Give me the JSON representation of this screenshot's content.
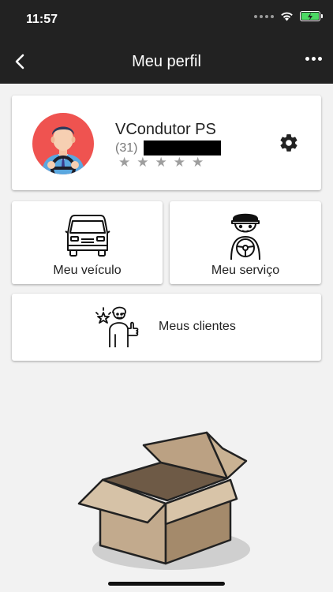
{
  "status_bar": {
    "time": "11:57"
  },
  "nav": {
    "title": "Meu perfil"
  },
  "profile": {
    "name": "VCondutor PS",
    "phone_prefix": "(31)",
    "rating_stars": 5,
    "rating_value": 0
  },
  "tiles": {
    "vehicle_label": "Meu veículo",
    "service_label": "Meu serviço",
    "clients_label": "Meus clientes"
  },
  "colors": {
    "header_bg": "#222222",
    "avatar_bg": "#ef5350",
    "battery": "#4cd964",
    "star_inactive": "#9e9e9e"
  }
}
